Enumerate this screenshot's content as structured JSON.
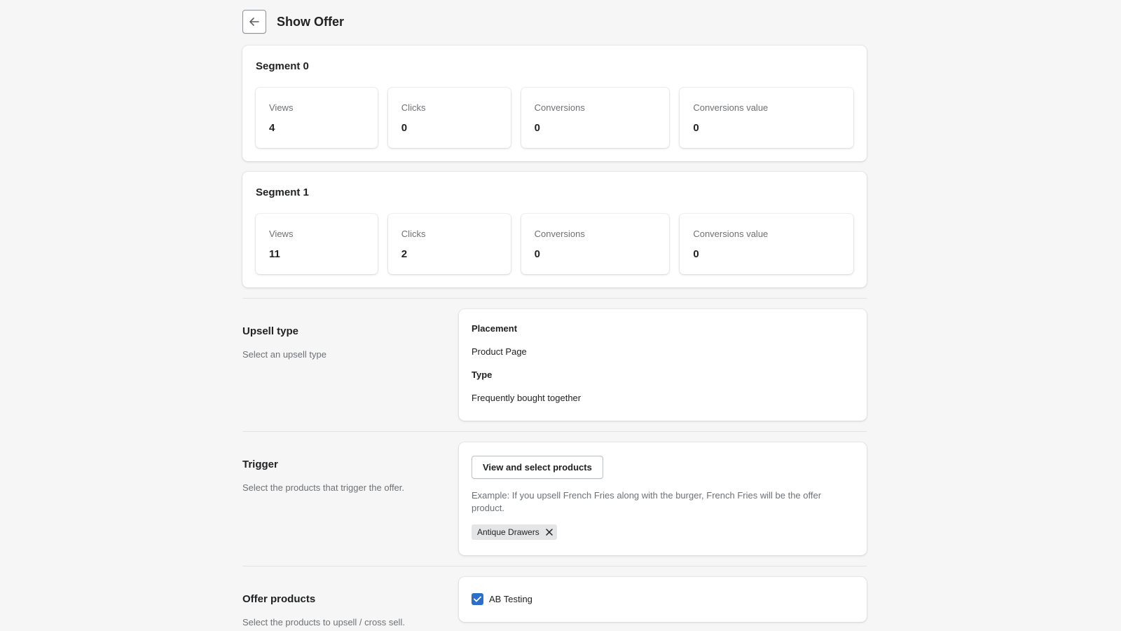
{
  "header": {
    "title": "Show Offer"
  },
  "segments": [
    {
      "title": "Segment 0",
      "stats": [
        {
          "label": "Views",
          "value": "4"
        },
        {
          "label": "Clicks",
          "value": "0"
        },
        {
          "label": "Conversions",
          "value": "0"
        },
        {
          "label": "Conversions value",
          "value": "0"
        }
      ]
    },
    {
      "title": "Segment 1",
      "stats": [
        {
          "label": "Views",
          "value": "11"
        },
        {
          "label": "Clicks",
          "value": "2"
        },
        {
          "label": "Conversions",
          "value": "0"
        },
        {
          "label": "Conversions value",
          "value": "0"
        }
      ]
    }
  ],
  "upsell": {
    "title": "Upsell type",
    "description": "Select an upsell type",
    "placement_label": "Placement",
    "placement_value": "Product Page",
    "type_label": "Type",
    "type_value": "Frequently bought together"
  },
  "trigger": {
    "title": "Trigger",
    "description": "Select the products that trigger the offer.",
    "button_label": "View and select products",
    "hint": "Example: If you upsell French Fries along with the burger, French Fries will be the offer product.",
    "tags": [
      "Antique Drawers"
    ]
  },
  "offer_products": {
    "title": "Offer products",
    "description": "Select the products to upsell / cross sell.",
    "ab_testing_label": "AB Testing",
    "ab_testing_checked": true
  },
  "colors": {
    "background": "#f6f6f7",
    "accent": "#2c6ecb",
    "muted_text": "#6d7175"
  }
}
